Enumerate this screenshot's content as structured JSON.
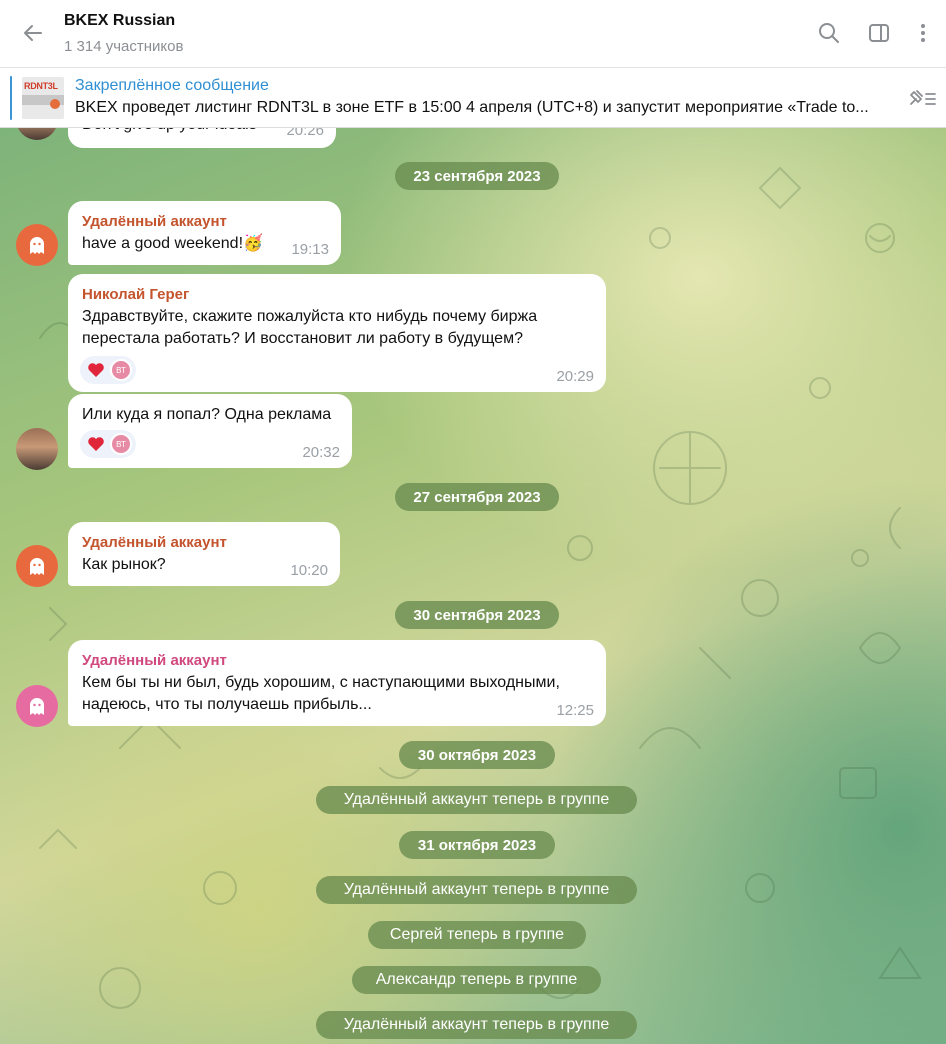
{
  "header": {
    "title": "BKEX Russian",
    "subtitle": "1 314 участников"
  },
  "pinned": {
    "title": "Закреплённое сообщение",
    "text": "BKEX проведет листинг RDNT3L в зоне ETF в 15:00 4 апреля (UTC+8) и запустит мероприятие «Trade to...",
    "thumb_logo": "RDNT3L"
  },
  "chat": {
    "partial": {
      "text": "Don't give up your ideals",
      "time": "20:26"
    },
    "dates": [
      "23 сентября 2023",
      "27 сентября 2023",
      "30 сентября 2023",
      "30 октября 2023",
      "31 октября 2023"
    ],
    "messages": [
      {
        "sender": "Удалённый аккаунт",
        "sender_color": "#c4542e",
        "text": "have a good weekend!🥳",
        "time": "19:13"
      },
      {
        "sender": "Николай Герег",
        "sender_color": "#c4542e",
        "lines": [
          "Здравствуйте, скажите пожалуйста кто нибудь почему биржа",
          "перестала работать? И восстановит ли работу в будущем?"
        ],
        "reaction_initials": "ВТ",
        "time": "20:29"
      },
      {
        "text": "Или куда я попал? Одна реклама",
        "reaction_initials": "ВТ",
        "time": "20:32"
      },
      {
        "sender": "Удалённый аккаунт",
        "sender_color": "#c4542e",
        "text": "Как рынок?",
        "time": "10:20"
      },
      {
        "sender": "Удалённый аккаунт",
        "sender_color": "#d0497f",
        "lines": [
          "Кем бы ты ни был, будь хорошим, с наступающими выходными,",
          "надеюсь, что ты получаешь прибыль..."
        ],
        "time": "12:25"
      }
    ],
    "service": [
      "Удалённый аккаунт теперь в группе",
      "Удалённый аккаунт теперь в группе",
      "Сергей теперь в группе",
      "Александр теперь в группе",
      "Удалённый аккаунт теперь в группе"
    ]
  },
  "icons": {
    "back": "arrow-left-icon",
    "search": "search-icon",
    "sidebar": "sidebar-toggle-icon",
    "menu": "more-vertical-icon",
    "pinned_list": "pinned-list-icon",
    "ghost": "ghost-icon",
    "heart": "heart-icon"
  },
  "colors": {
    "accent": "#2f8fd2",
    "sender_orange": "#c4542e",
    "sender_pink": "#d0497f",
    "pill_bg": "#698c50",
    "heart": "#e0263a"
  }
}
